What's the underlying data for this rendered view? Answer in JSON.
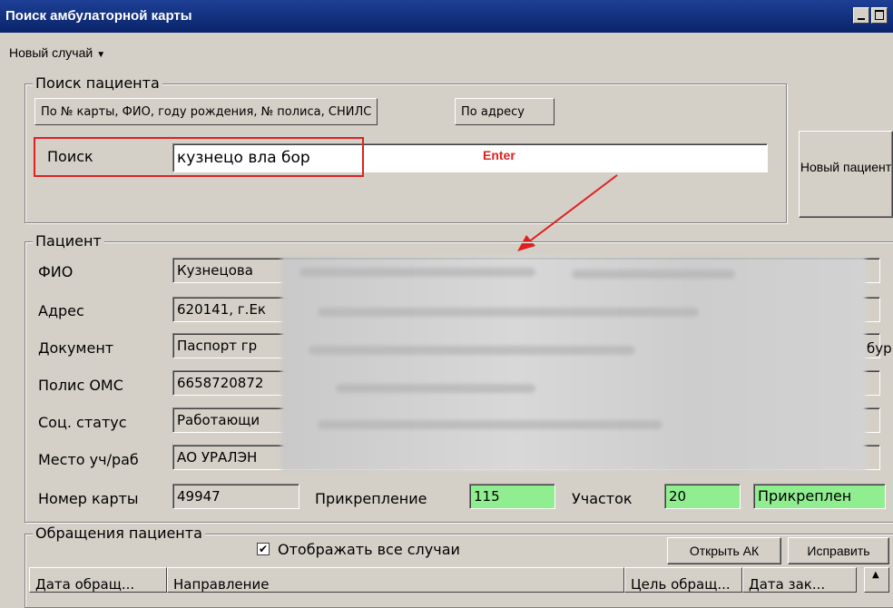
{
  "window": {
    "title": "Поиск амбулаторной карты"
  },
  "menu": {
    "new_case": "Новый случай"
  },
  "search_group": {
    "legend": "Поиск пациента",
    "tabs": [
      "По № карты, ФИО, году рождения, № полиса, СНИЛС",
      "По адресу"
    ],
    "search_label": "Поиск",
    "search_value": "кузнецо вла бор",
    "annotation": "Enter",
    "new_patient_button": "Новый пациент"
  },
  "patient_group": {
    "legend": "Пациент",
    "fields": [
      {
        "label": "ФИО",
        "value": "Кузнецова"
      },
      {
        "label": "Адрес",
        "value": "620141, г.Ек"
      },
      {
        "label": "Документ",
        "value": "Паспорт гр"
      },
      {
        "label": "Полис ОМС",
        "value": "6658720872"
      },
      {
        "label": "Соц. статус",
        "value": "Работающи"
      },
      {
        "label": "Место уч/раб",
        "value": "АО УРАЛЭН"
      }
    ],
    "card_number_label": "Номер карты",
    "card_number": "49947",
    "attachment_label": "Прикрепление",
    "attachment": "115",
    "district_label": "Участок",
    "district": "20",
    "attached_status": "Прикреплен",
    "right_partial_text": "бур"
  },
  "visits_group": {
    "legend": "Обращения пациента",
    "show_all_label": "Отображать все случаи",
    "show_all_checked": true,
    "open_ak_button": "Открыть АК",
    "edit_button": "Исправить",
    "columns": [
      "Дата обращ...",
      "Направление",
      "Цель обращ...",
      "Дата зак..."
    ]
  },
  "colors": {
    "accent_green": "#90ee90",
    "annotation_red": "#e02020",
    "title_blue": "#0a246a"
  }
}
